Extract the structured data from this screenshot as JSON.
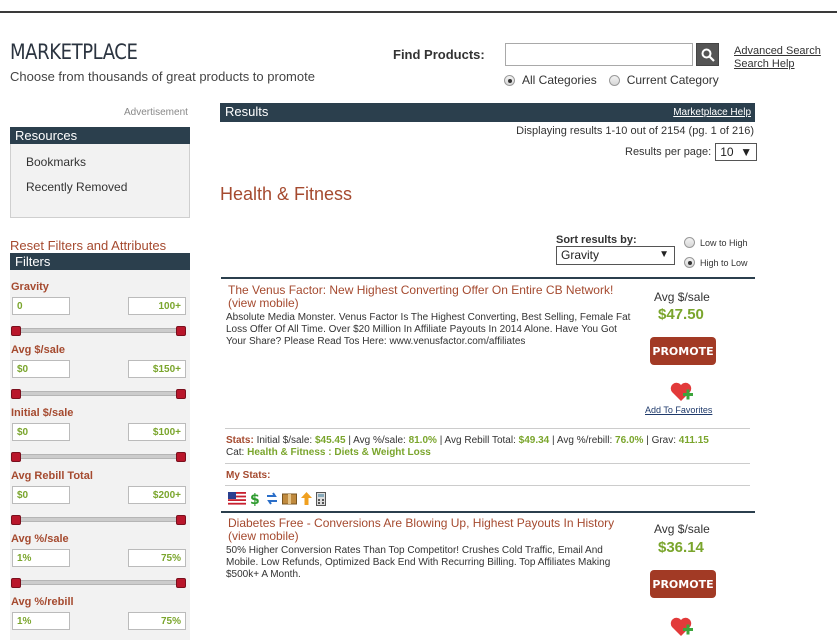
{
  "header": {
    "title": "MARKETPLACE",
    "subtitle": "Choose from thousands of great products to promote",
    "find_label": "Find Products:",
    "search_value": "",
    "advanced_search": "Advanced Search",
    "search_help": "Search Help",
    "radio_all": "All Categories",
    "radio_current": "Current Category"
  },
  "sidebar": {
    "advertisement": "Advertisement",
    "resources_title": "Resources",
    "resources": [
      "Bookmarks",
      "Recently Removed"
    ],
    "reset_link": "Reset Filters and Attributes",
    "filters_title": "Filters",
    "filters": [
      {
        "label": "Gravity",
        "min": "0",
        "max": "100+"
      },
      {
        "label": "Avg $/sale",
        "min": "$0",
        "max": "$150+"
      },
      {
        "label": "Initial $/sale",
        "min": "$0",
        "max": "$100+"
      },
      {
        "label": "Avg Rebill Total",
        "min": "$0",
        "max": "$200+"
      },
      {
        "label": "Avg %/sale",
        "min": "1%",
        "max": "75%"
      },
      {
        "label": "Avg %/rebill",
        "min": "1%",
        "max": "75%"
      }
    ]
  },
  "results": {
    "title": "Results",
    "help": "Marketplace Help",
    "displaying": "Displaying results 1-10 out of 2154 (pg. 1 of 216)",
    "per_page_label": "Results per page:",
    "per_page": "10",
    "category": "Health & Fitness",
    "sort_label": "Sort results by:",
    "sort_value": "Gravity",
    "low_to_high": "Low to High",
    "high_to_low": "High to Low"
  },
  "products": [
    {
      "title": "The Venus Factor: New Highest Converting Offer On Entire CB Network!",
      "view_mobile": "(view mobile)",
      "description": "Absolute Media Monster. Venus Factor Is The Highest Converting, Best Selling, Female Fat Loss Offer Of All Time. Over $20 Million In Affiliate Payouts In 2014 Alone. Have You Got Your Share? Please Read Tos Here: www.venusfactor.com/affiliates",
      "avg_label": "Avg $/sale",
      "avg_value": "$47.50",
      "promote": "PROMOTE",
      "add_fav": "Add To Favorites",
      "stats": {
        "label": "Stats:",
        "initial_label": "Initial $/sale:",
        "initial": "$45.45",
        "avg_pct_label": "Avg %/sale:",
        "avg_pct": "81.0%",
        "rebill_label": "Avg Rebill Total:",
        "rebill": "$49.34",
        "pct_rebill_label": "Avg %/rebill:",
        "pct_rebill": "76.0%",
        "grav_label": "Grav:",
        "grav": "411.15",
        "cat_label": "Cat:",
        "cat": "Health & Fitness : Diets & Weight Loss"
      },
      "my_stats": "My Stats:"
    },
    {
      "title": "Diabetes Free - Conversions Are Blowing Up, Highest Payouts In History",
      "view_mobile": "(view mobile)",
      "description": "50% Higher Conversion Rates Than Top Competitor! Crushes Cold Traffic, Email And Mobile. Low Refunds, Optimized Back End With Recurring Billing. Top Affiliates Making $500k+ A Month.",
      "avg_label": "Avg $/sale",
      "avg_value": "$36.14",
      "promote": "PROMOTE"
    }
  ],
  "colors": {
    "accent_dark": "#2b3f4d",
    "brand_red": "#a54a2f",
    "value_green": "#7aa52c",
    "promote_bg": "#a23a25"
  }
}
